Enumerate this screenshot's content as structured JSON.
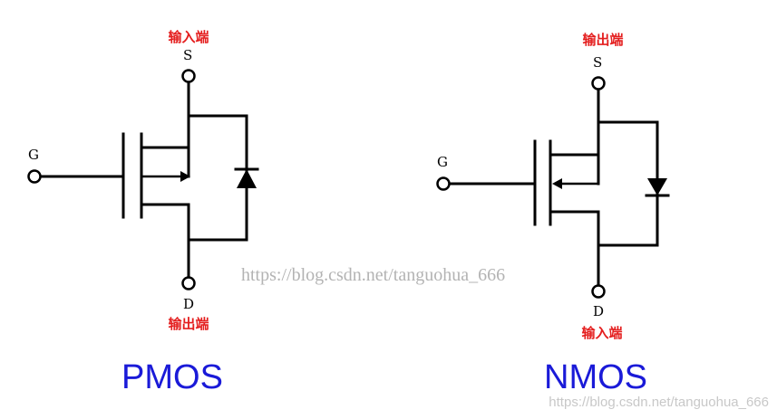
{
  "colors": {
    "io_label": "#e41e1e",
    "title": "#1a1ad8",
    "watermark": "#b3b3b3",
    "line": "#000000"
  },
  "pmos": {
    "title": "PMOS",
    "gate_label": "G",
    "source_label": "S",
    "drain_label": "D",
    "source_io": "输入端",
    "drain_io": "输出端"
  },
  "nmos": {
    "title": "NMOS",
    "gate_label": "G",
    "source_label": "S",
    "drain_label": "D",
    "source_io": "输出端",
    "drain_io": "输入端"
  },
  "watermark": {
    "center": "https://blog.csdn.net/tanguohua_666",
    "corner": "https://blog.csdn.net/tanguohua_666"
  }
}
